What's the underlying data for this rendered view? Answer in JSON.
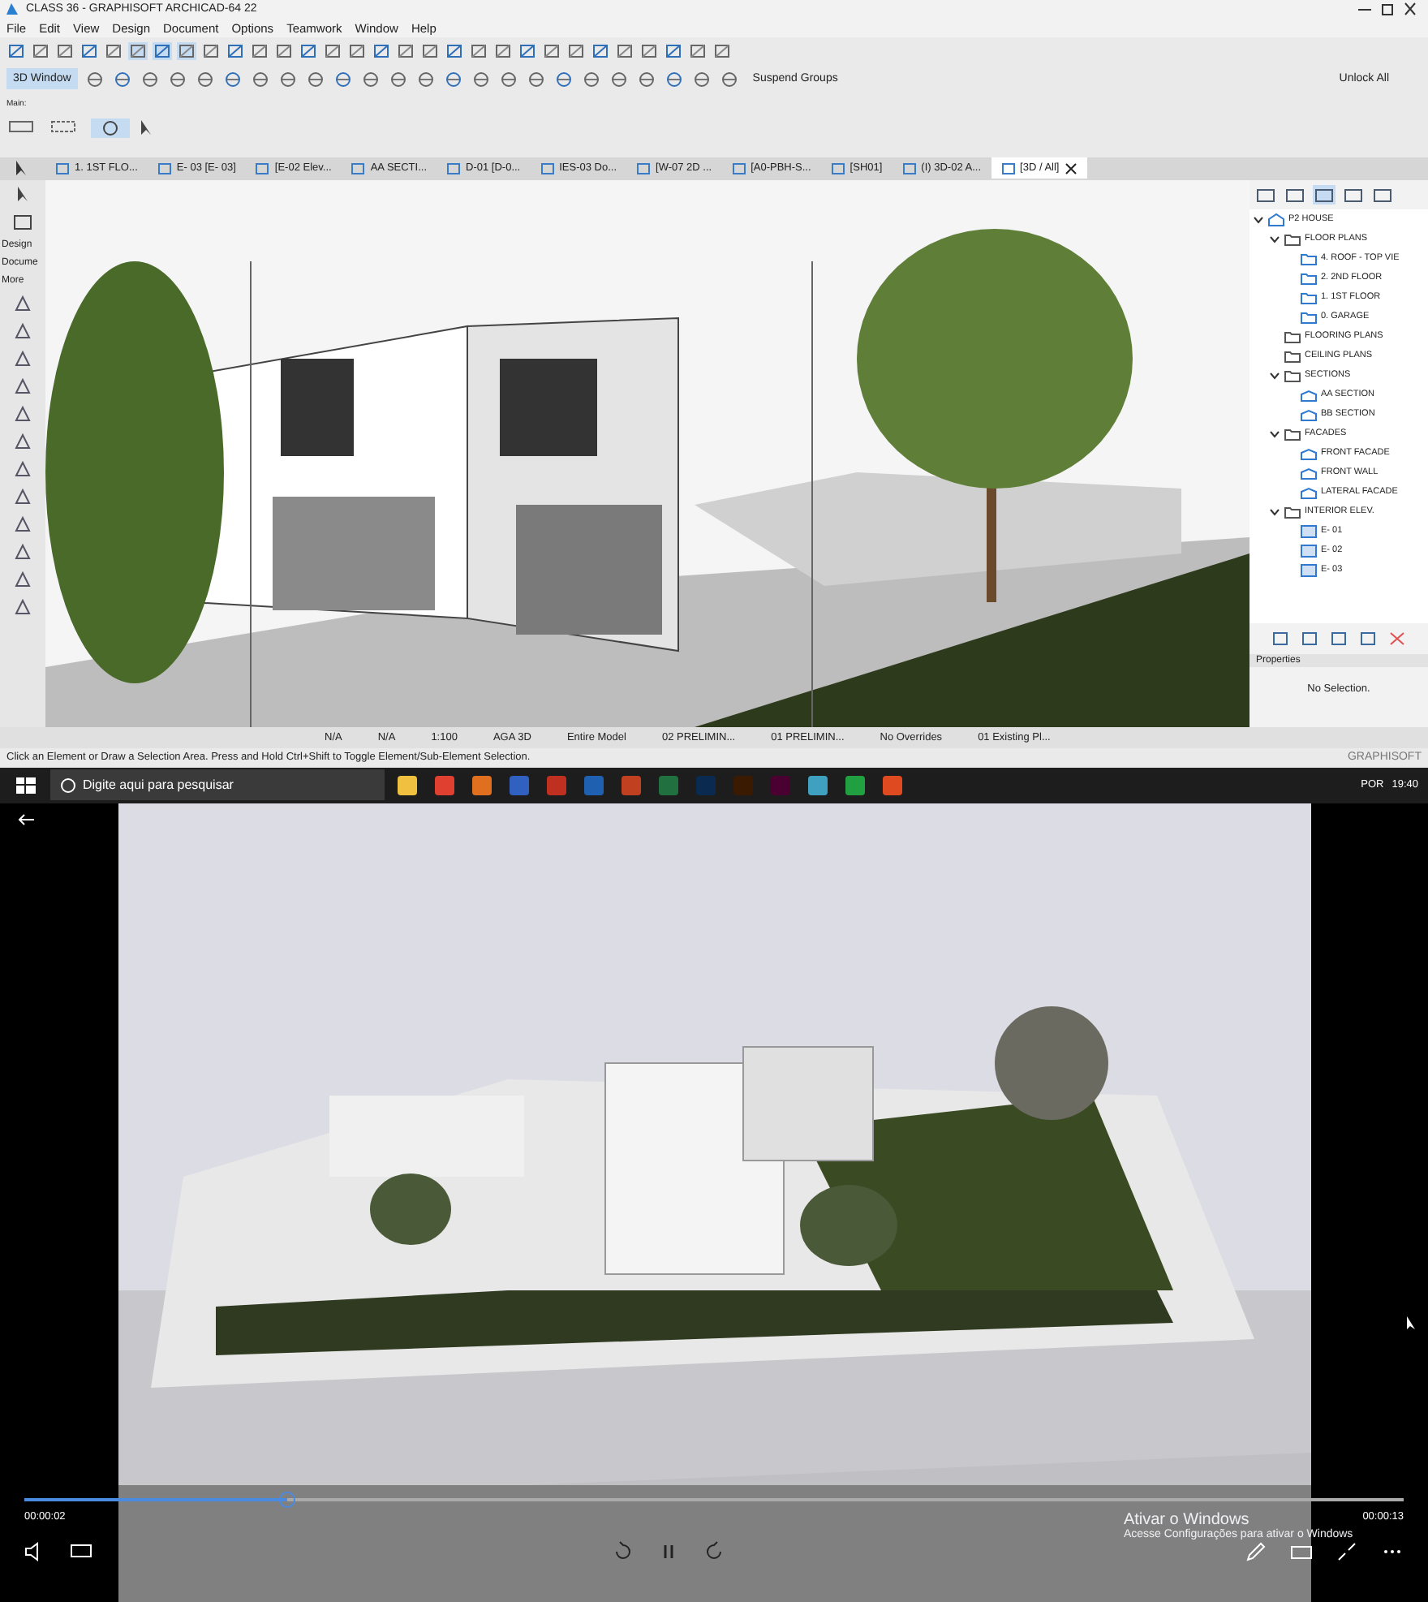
{
  "window": {
    "title": "CLASS 36 - GRAPHISOFT ARCHICAD-64 22"
  },
  "menu": [
    "File",
    "Edit",
    "View",
    "Design",
    "Document",
    "Options",
    "Teamwork",
    "Window",
    "Help"
  ],
  "toolbar": {
    "view_button": "3D Window",
    "suspend_button": "Suspend Groups",
    "unlock_button": "Unlock All",
    "palette_label": "Main:"
  },
  "tabs": [
    {
      "label": "1. 1ST FLO...",
      "selected": false
    },
    {
      "label": "E- 03 [E- 03]",
      "selected": false
    },
    {
      "label": "[E-02 Elev...",
      "selected": false
    },
    {
      "label": "AA SECTI...",
      "selected": false
    },
    {
      "label": "D-01 [D-0...",
      "selected": false
    },
    {
      "label": "IES-03 Do...",
      "selected": false
    },
    {
      "label": "[W-07 2D ...",
      "selected": false
    },
    {
      "label": "[A0-PBH-S...",
      "selected": false
    },
    {
      "label": "[SH01]",
      "selected": false
    },
    {
      "label": "(I) 3D-02 A...",
      "selected": false
    },
    {
      "label": "[3D / All]",
      "selected": true
    }
  ],
  "toolbox": {
    "labels": [
      "Design",
      "Docume",
      "More"
    ]
  },
  "navigator": {
    "tree": [
      {
        "label": "P2 HOUSE",
        "kind": "project",
        "expanded": true,
        "children": [
          {
            "label": "FLOOR PLANS",
            "kind": "folder",
            "expanded": true,
            "children": [
              {
                "label": "4. ROOF - TOP VIE",
                "kind": "plan"
              },
              {
                "label": "2. 2ND FLOOR",
                "kind": "plan"
              },
              {
                "label": "1. 1ST FLOOR",
                "kind": "plan"
              },
              {
                "label": "0. GARAGE",
                "kind": "plan"
              }
            ]
          },
          {
            "label": "FLOORING PLANS",
            "kind": "folder"
          },
          {
            "label": "CEILING PLANS",
            "kind": "folder"
          },
          {
            "label": "SECTIONS",
            "kind": "folder",
            "expanded": true,
            "children": [
              {
                "label": "AA SECTION",
                "kind": "section"
              },
              {
                "label": "BB SECTION",
                "kind": "section"
              }
            ]
          },
          {
            "label": "FACADES",
            "kind": "folder",
            "expanded": true,
            "children": [
              {
                "label": "FRONT FACADE",
                "kind": "section"
              },
              {
                "label": "FRONT WALL",
                "kind": "section"
              },
              {
                "label": "LATERAL FACADE",
                "kind": "section"
              }
            ]
          },
          {
            "label": "INTERIOR ELEV.",
            "kind": "folder",
            "expanded": true,
            "children": [
              {
                "label": "E- 01",
                "kind": "elevation"
              },
              {
                "label": "E- 02",
                "kind": "elevation"
              },
              {
                "label": "E- 03",
                "kind": "elevation"
              }
            ]
          }
        ]
      }
    ]
  },
  "properties": {
    "title": "Properties",
    "message": "No Selection."
  },
  "view_bar": [
    "N/A",
    "N/A",
    "1:100",
    "AGA 3D",
    "Entire Model",
    "02 PRELIMIN...",
    "01 PRELIMIN...",
    "No Overrides",
    "01 Existing Pl..."
  ],
  "hint": "Click an Element or Draw a Selection Area. Press and Hold Ctrl+Shift to Toggle Element/Sub-Element Selection.",
  "brand": "GRAPHISOFT",
  "taskbar": {
    "search_placeholder": "Digite aqui para pesquisar",
    "language": "POR",
    "time": "19:40"
  },
  "player": {
    "elapsed": "00:00:02",
    "total": "00:00:13",
    "level": 0.19,
    "notice_title": "Ativar o Windows",
    "notice_text": "Acesse Configurações para ativar o Windows"
  }
}
